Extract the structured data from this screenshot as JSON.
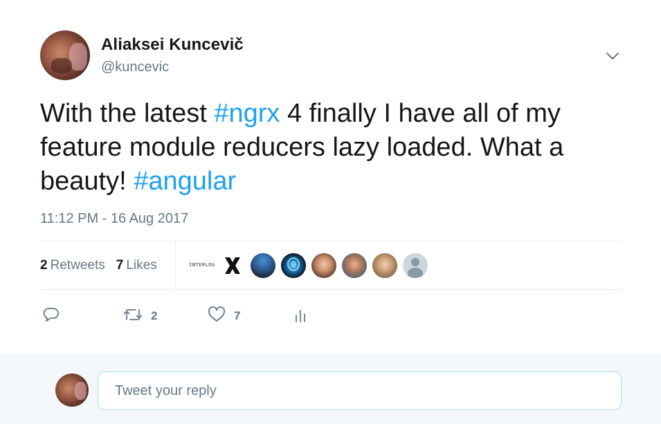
{
  "author": {
    "name": "Aliaksei Kuncevič",
    "handle": "@kuncevic"
  },
  "tweet": {
    "text_1": "With the latest ",
    "hashtag_1": "#ngrx",
    "text_2": " 4 finally I have all of my feature module reducers lazy loaded. What a beauty! ",
    "hashtag_2": "#angular",
    "timestamp": "11:12 PM - 16 Aug 2017"
  },
  "stats": {
    "retweets_count": "2",
    "retweets_label": "Retweets",
    "likes_count": "7",
    "likes_label": "Likes"
  },
  "likers": [
    {
      "icon": "interlogic-logo-avatar",
      "text": "INTERLOGIC"
    },
    {
      "icon": "x-logo-avatar"
    },
    {
      "icon": "photo-avatar-blue"
    },
    {
      "icon": "brain-glow-avatar"
    },
    {
      "icon": "photo-avatar-face"
    },
    {
      "icon": "photo-avatar-face"
    },
    {
      "icon": "photo-avatar-face"
    },
    {
      "icon": "default-user-avatar"
    }
  ],
  "actions": {
    "reply_count": "",
    "retweet_count": "2",
    "like_count": "7"
  },
  "reply": {
    "placeholder": "Tweet your reply"
  },
  "colors": {
    "link": "#1da1f2",
    "secondary_text": "#657786",
    "divider": "#e6ecf0",
    "reply_bar_bg": "#f5f8fa",
    "input_border": "#a4d9f9"
  }
}
